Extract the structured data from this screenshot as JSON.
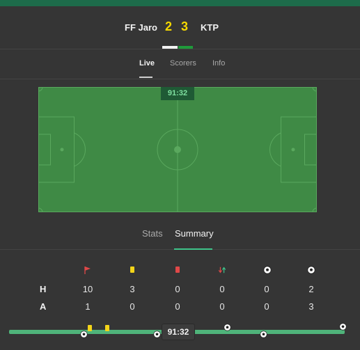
{
  "match": {
    "home_team": "FF Jaro",
    "away_team": "KTP",
    "home_score": "2",
    "away_score": "3"
  },
  "nav_tabs": [
    "Live",
    "Scorers",
    "Info"
  ],
  "pitch": {
    "clock": "91:32"
  },
  "sub_tabs": [
    "Stats",
    "Summary"
  ],
  "stats": {
    "icons": [
      "corner-flag-icon",
      "yellow-card-icon",
      "red-card-icon",
      "substitution-icon",
      "goal-icon",
      "goal-icon"
    ],
    "rows": [
      {
        "label": "H",
        "values": [
          "10",
          "3",
          "0",
          "0",
          "0",
          "2"
        ]
      },
      {
        "label": "A",
        "values": [
          "1",
          "0",
          "0",
          "0",
          "0",
          "3"
        ]
      }
    ]
  },
  "timeline": {
    "time": "91:32"
  },
  "colors": {
    "accent": "#3ec48a",
    "pitch": "#3f8a45",
    "score": "#f5d800"
  }
}
